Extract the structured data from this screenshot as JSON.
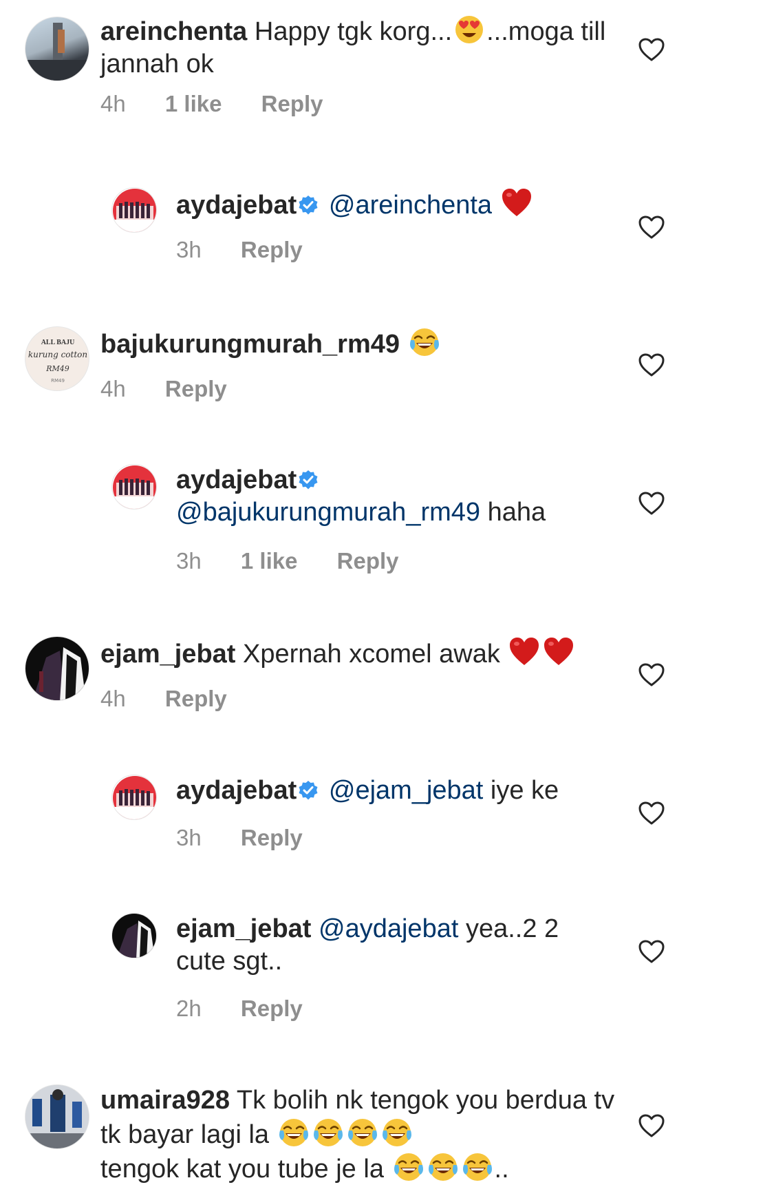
{
  "comments": [
    {
      "username": "areinchenta",
      "text": "Happy tgk korg...",
      "emoji1": "smiling-face-with-heart-eyes",
      "text_after": "...moga till jannah ok",
      "time": "4h",
      "likes": "1 like",
      "reply": "Reply"
    },
    {
      "username": "aydajebat",
      "mention": "@areinchenta",
      "emoji1": "red-heart",
      "time": "3h",
      "reply": "Reply"
    },
    {
      "username": "bajukurungmurah_rm49",
      "emoji1": "face-with-tears-of-joy",
      "time": "4h",
      "reply": "Reply",
      "avatar_text": {
        "line1": "ALL BAJU",
        "line2": "kurung cotton",
        "line3": "RM49",
        "line4": "RM49"
      }
    },
    {
      "username": "aydajebat",
      "mention": "@bajukurungmurah_rm49",
      "text_after": "haha",
      "time": "3h",
      "likes": "1 like",
      "reply": "Reply"
    },
    {
      "username": "ejam_jebat",
      "text": "Xpernah xcomel awak",
      "emoji1": "red-heart",
      "time": "4h",
      "reply": "Reply"
    },
    {
      "username": "aydajebat",
      "mention": "@ejam_jebat",
      "text_after": "iye ke",
      "time": "3h",
      "reply": "Reply"
    },
    {
      "username": "ejam_jebat",
      "mention": "@aydajebat",
      "text_after": "yea..2 2 cute sgt..",
      "time": "2h",
      "reply": "Reply"
    },
    {
      "username": "umaira928",
      "text": "Tk bolih nk tengok you berdua tv tk bayar lagi la",
      "text_line3": "tengok kat you tube je la",
      "text_end": "..",
      "emoji1": "face-with-tears-of-joy"
    }
  ],
  "colors": {
    "mention": "#003569",
    "meta": "#8e8e8e",
    "verified": "#3897f0",
    "heart_emoji": "#d31b1b"
  }
}
